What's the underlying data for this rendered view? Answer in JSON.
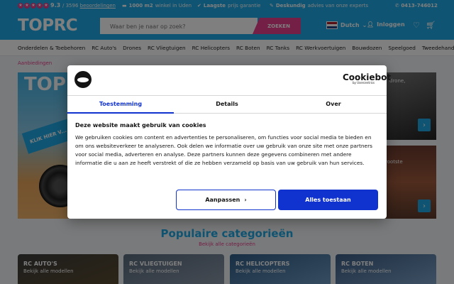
{
  "topbar": {
    "rating": "9.3",
    "reviews_count": "/ 3596",
    "reviews_link": "beoordelingen",
    "usp1_bold": "1000 m2",
    "usp1_text": "winkel in Uden",
    "usp2_bold": "Laagste",
    "usp2_text": "prijs garantie",
    "usp3_bold": "Deskundig",
    "usp3_text": "advies van onze experts",
    "phone": "0413-746012"
  },
  "header": {
    "logo": "TOPRC",
    "search_placeholder": "Waar ben je naar op zoek?",
    "search_button": "ZOEKEN",
    "language": "Dutch",
    "login": "Inloggen"
  },
  "nav": {
    "items": [
      "Onderdelen & Toebehoren",
      "RC Auto's",
      "Drones",
      "RC Vliegtuigen",
      "RC Helicopters",
      "RC Boten",
      "RC Tanks",
      "RC Werkvoertuigen",
      "Bouwdozen",
      "Speelgoed",
      "Tweedehands"
    ]
  },
  "breadcrumb": "Aanbiedingen",
  "hero": {
    "brand": "TOPRC",
    "ribbon": "KLIK HIER V... POWER",
    "side1": "drone,",
    "side2": "rootste"
  },
  "categories": {
    "title": "Populaire categorieën",
    "subtitle": "Bekijk alle categorieën",
    "cards": [
      {
        "name": "RC AUTO'S",
        "sub": "Bekijk alle modellen"
      },
      {
        "name": "RC VLIEGTUIGEN",
        "sub": "Bekijk alle modellen"
      },
      {
        "name": "RC HELICOPTERS",
        "sub": "Bekijk alle modellen"
      },
      {
        "name": "RC BOTEN",
        "sub": "Bekijk alle modellen"
      }
    ]
  },
  "cookie": {
    "brand": "Cookiebot",
    "brand_sub": "by Usercentrics",
    "tabs": [
      "Toestemming",
      "Details",
      "Over"
    ],
    "title": "Deze website maakt gebruik van cookies",
    "body": "We gebruiken cookies om content en advertenties te personaliseren, om functies voor social media te bieden en om ons websiteverkeer te analyseren. Ook delen we informatie over uw gebruik van onze site met onze partners voor social media, adverteren en analyse. Deze partners kunnen deze gegevens combineren met andere informatie die u aan ze heeft verstrekt of die ze hebben verzameld op basis van uw gebruik van hun services.",
    "customize": "Aanpassen",
    "allow_all": "Alles toestaan"
  },
  "colors": {
    "brand_blue": "#1fa9e4",
    "brand_pink": "#e83e8c",
    "cookie_blue": "#1032cf"
  }
}
